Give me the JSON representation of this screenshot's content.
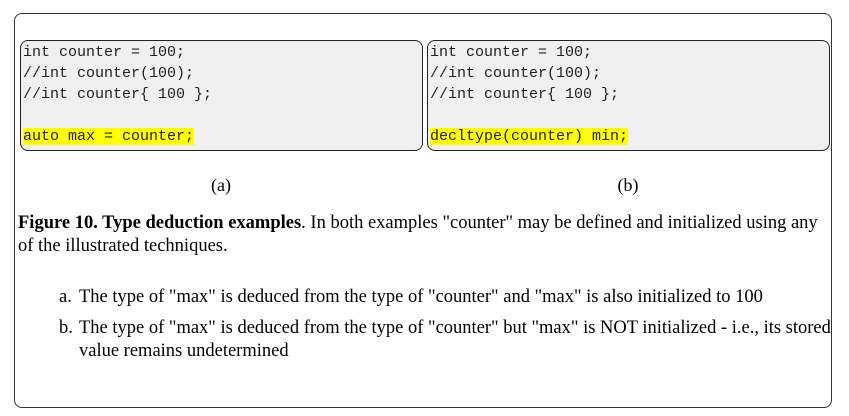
{
  "code_a": {
    "lines": [
      "int counter = 100;",
      "//int counter(100);",
      "//int counter{ 100 };",
      "",
      "auto max = counter;"
    ],
    "label": "(a)"
  },
  "code_b": {
    "lines": [
      "int counter = 100;",
      "//int counter(100);",
      "//int counter{ 100 };",
      "",
      "decltype(counter) min;"
    ],
    "label": "(b)"
  },
  "caption": {
    "title": "Figure 10. Type deduction examples",
    "text": ". In both examples \"counter\" may be defined and initialized using any of the illustrated techniques."
  },
  "notes": [
    {
      "marker": "a.",
      "text": "The type of \"max\" is deduced from the type of \"counter\" and \"max\" is also initialized to 100"
    },
    {
      "marker": "b.",
      "text": "The type of \"max\" is deduced from the type of \"counter\" but \"max\" is NOT initialized - i.e., its stored value remains undetermined"
    }
  ],
  "colors": {
    "highlight": "#ffff00",
    "code_background": "#f0f0f0"
  }
}
